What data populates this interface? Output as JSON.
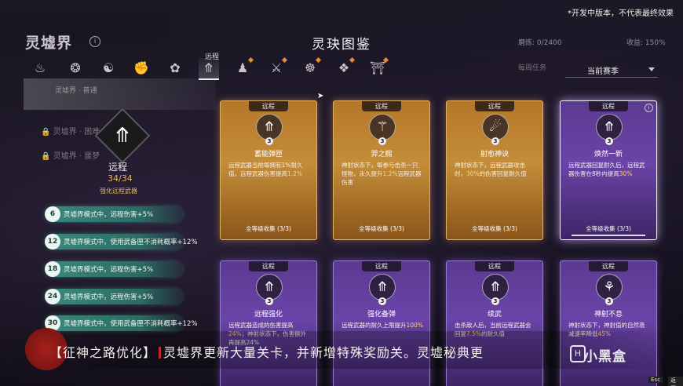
{
  "disclaimer": "*开发中版本，不代表最终效果",
  "realm_title": "灵墟界",
  "page_title": "灵玦图鉴",
  "header_right": {
    "progress": "磨炼: 0/2400",
    "zoom": "收益: 150%",
    "task_label": "每周任务",
    "season_select": "当前赛季"
  },
  "tabs": {
    "active_label": "远程",
    "items": [
      {
        "icon": "flame-icon",
        "glyph": "♨"
      },
      {
        "icon": "swirl-icon",
        "glyph": "❂"
      },
      {
        "icon": "yin-yang-icon",
        "glyph": "☯"
      },
      {
        "icon": "fist-icon",
        "glyph": "✊"
      },
      {
        "icon": "lotus-icon",
        "glyph": "✿"
      },
      {
        "icon": "ranged-arrow-icon",
        "glyph": "⤊"
      },
      {
        "icon": "figure-icon",
        "glyph": "♟"
      },
      {
        "icon": "crossed-swords-icon",
        "glyph": "⚔"
      },
      {
        "icon": "meditation-icon",
        "glyph": "☸"
      },
      {
        "icon": "knot-icon",
        "glyph": "❖"
      },
      {
        "icon": "gate-icon",
        "glyph": "⛩"
      }
    ]
  },
  "left_panel": {
    "band_text": "灵墟界 · 普通",
    "locked_rows": [
      "灵墟界 · 困难",
      "灵墟界 · 噩梦"
    ],
    "category_name": "远程",
    "category_count": "34/34",
    "category_sub": "强化远程武器",
    "emblem_glyph": "⤊",
    "tiers": [
      {
        "level": "6",
        "text": "灵墟界模式中，远程伤害+5%"
      },
      {
        "level": "12",
        "text": "灵墟界模式中，使用武备匣不消耗概率+12%"
      },
      {
        "level": "18",
        "text": "灵墟界模式中，远程伤害+5%"
      },
      {
        "level": "24",
        "text": "灵墟界模式中，远程伤害+5%"
      },
      {
        "level": "30",
        "text": "灵墟界模式中，使用武备匣不消耗概率+12%"
      }
    ]
  },
  "cards": [
    {
      "tag": "远程",
      "name": "蓄能弹匣",
      "level": "3",
      "glyph": "⤊",
      "rarity": "gold",
      "desc_pre": "远程武器当前每拥有1%耐久值，远程武器伤害提高",
      "desc_hl": "1.2%",
      "desc_post": "",
      "collect": "全等级收集 (3/3)"
    },
    {
      "tag": "远程",
      "name": "羿之赐",
      "level": "3",
      "glyph": "⚚",
      "rarity": "gold",
      "desc_pre": "神射状态下，每参与击杀一只怪物，永久提升",
      "desc_hl": "1.2%",
      "desc_post": "远程武器伤害",
      "collect": "全等级收集 (3/3)"
    },
    {
      "tag": "远程",
      "name": "射愈神诀",
      "level": "3",
      "glyph": "☄",
      "rarity": "gold",
      "desc_pre": "神射状态下，远程武器攻击时，",
      "desc_hl": "30%",
      "desc_post": "的伤害回复耐久值",
      "collect": "全等级收集 (3/3)"
    },
    {
      "tag": "远程",
      "name": "焕然一新",
      "level": "3",
      "glyph": "⤊",
      "rarity": "purple",
      "desc_pre": "远程武器回复耐久后，远程武器伤害在8秒内提高",
      "desc_hl": "30%",
      "desc_post": "",
      "collect": "全等级收集 (3/3)"
    },
    {
      "tag": "远程",
      "name": "远程强化",
      "level": "3",
      "glyph": "⤊",
      "rarity": "purple",
      "desc_pre": "远程武器造成的伤害提高",
      "desc_hl": "24%",
      "desc_post": "；神射状态下，伤害额外再提高24%",
      "collect": ""
    },
    {
      "tag": "远程",
      "name": "强化备弹",
      "level": "3",
      "glyph": "⤊",
      "rarity": "purple",
      "desc_pre": "远程武器的耐久上限提升",
      "desc_hl": "100%",
      "desc_post": "",
      "collect": ""
    },
    {
      "tag": "远程",
      "name": "续武",
      "level": "3",
      "glyph": "⤊",
      "rarity": "purple",
      "desc_pre": "击杀敌人后，当前远程武器会回复",
      "desc_hl": "7.5%",
      "desc_post": "的耐久值",
      "collect": ""
    },
    {
      "tag": "远程",
      "name": "神射不息",
      "level": "3",
      "glyph": "⚘",
      "rarity": "purple",
      "desc_pre": "神射状态下，神射值的自然衰减速率降低",
      "desc_hl": "45%",
      "desc_post": "",
      "collect": ""
    }
  ],
  "banner": {
    "part1": "【征神之路优化】",
    "part2": "灵墟界更新大量关卡，并新增特殊奖励关。灵墟秘典更"
  },
  "watermark": "小黑盒",
  "keys": {
    "esc": "Esc",
    "back": "返回"
  }
}
